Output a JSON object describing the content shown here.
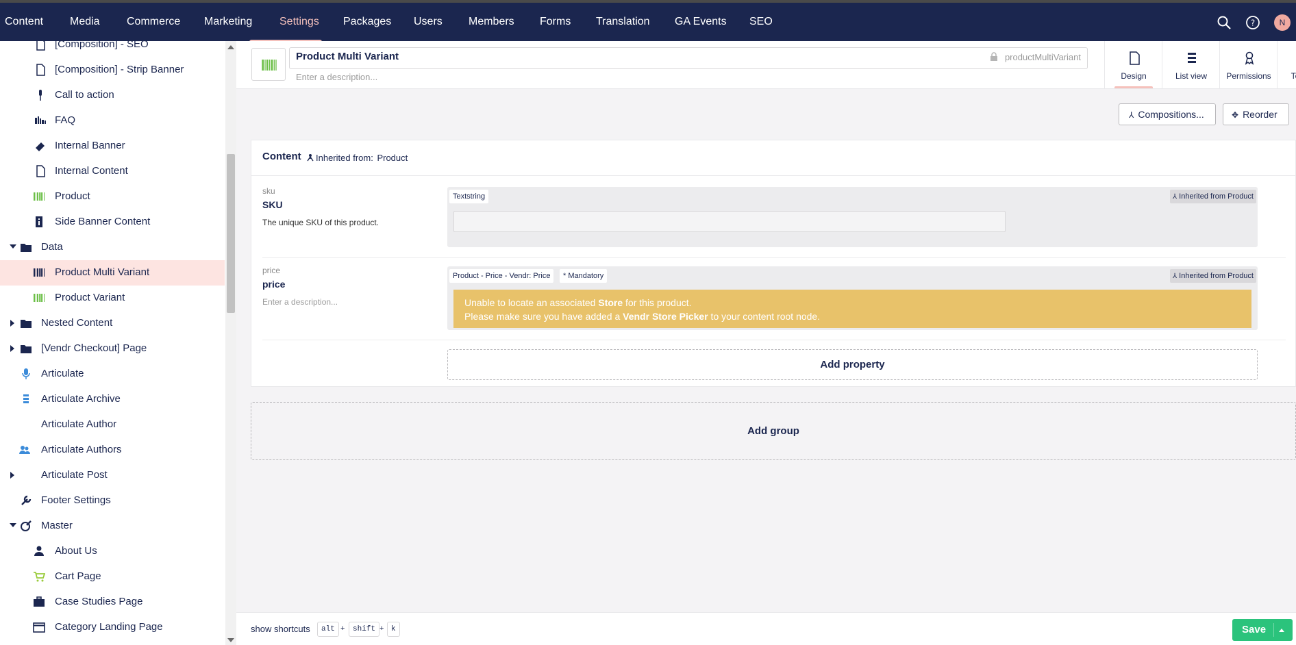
{
  "top_nav": {
    "items": [
      "Content",
      "Media",
      "Commerce",
      "Marketing",
      "Settings",
      "Packages",
      "Users",
      "Members",
      "Forms",
      "Translation",
      "GA Events",
      "SEO"
    ],
    "active": "Settings",
    "avatar_initial": "N",
    "icons": [
      "search-icon",
      "help-icon"
    ]
  },
  "sidebar": {
    "items": [
      {
        "label": "[Composition] - SEO",
        "icon": "document-icon"
      },
      {
        "label": "[Composition] - Strip Banner",
        "icon": "document-icon"
      },
      {
        "label": "Call to action",
        "icon": "microphone-icon"
      },
      {
        "label": "FAQ",
        "icon": "faq-icon"
      },
      {
        "label": "Internal Banner",
        "icon": "eraser-icon"
      },
      {
        "label": "Internal Content",
        "icon": "document-icon"
      },
      {
        "label": "Product",
        "icon": "barcode-icon"
      },
      {
        "label": "Side Banner Content",
        "icon": "sidebar-icon"
      },
      {
        "label": "Data",
        "icon": "folder-icon"
      },
      {
        "label": "Product Multi Variant",
        "icon": "barcode-icon"
      },
      {
        "label": "Product Variant",
        "icon": "barcode-icon"
      },
      {
        "label": "Nested Content",
        "icon": "folder-icon"
      },
      {
        "label": "[Vendr Checkout] Page",
        "icon": "folder-icon"
      },
      {
        "label": "Articulate",
        "icon": "microphone-icon"
      },
      {
        "label": "Articulate Archive",
        "icon": "list-icon"
      },
      {
        "label": "Articulate Author",
        "icon": ""
      },
      {
        "label": "Articulate Authors",
        "icon": "users-icon"
      },
      {
        "label": "Articulate Post",
        "icon": ""
      },
      {
        "label": "Footer Settings",
        "icon": "wrench-icon"
      },
      {
        "label": "Master",
        "icon": "palette-icon"
      },
      {
        "label": "About Us",
        "icon": "user-icon"
      },
      {
        "label": "Cart Page",
        "icon": "cart-icon"
      },
      {
        "label": "Case Studies Page",
        "icon": "briefcase-icon"
      },
      {
        "label": "Category Landing Page",
        "icon": "window-icon"
      }
    ]
  },
  "header": {
    "name": "Product Multi Variant",
    "alias": "productMultiVariant",
    "description_placeholder": "Enter a description...",
    "tabs": [
      "Design",
      "List view",
      "Permissions",
      "Templates"
    ],
    "active_tab": "Design"
  },
  "toolbar": {
    "compositions_label": "Compositions...",
    "reorder_label": "Reorder"
  },
  "group": {
    "title": "Content",
    "inherited_label": "Inherited from:",
    "inherited_from": "Product",
    "properties": [
      {
        "alias": "sku",
        "name": "SKU",
        "description": "The unique SKU of this product.",
        "editor": "Textstring",
        "inherited_badge": "Inherited from Product"
      },
      {
        "alias": "price",
        "name": "price",
        "description_placeholder": "Enter a description...",
        "editor": "Product - Price - Vendr: Price",
        "mandatory": "* Mandatory",
        "inherited_badge": "Inherited from Product",
        "warning_line1_pre": "Unable to locate an associated ",
        "warning_line1_bold": "Store",
        "warning_line1_post": " for this product.",
        "warning_line2_pre": "Please make sure you have added a ",
        "warning_line2_bold": "Vendr Store Picker",
        "warning_line2_post": " to your content root node."
      }
    ],
    "add_property_label": "Add property"
  },
  "add_group_label": "Add group",
  "footer": {
    "shortcuts_label": "show shortcuts",
    "keys": [
      "alt",
      "shift",
      "k"
    ],
    "save_label": "Save"
  },
  "colors": {
    "topbar": "#1b264f",
    "accent": "#f5c1bc",
    "save": "#2bc37c",
    "warning": "#e8c26a",
    "selected_row": "#fde4e1"
  }
}
